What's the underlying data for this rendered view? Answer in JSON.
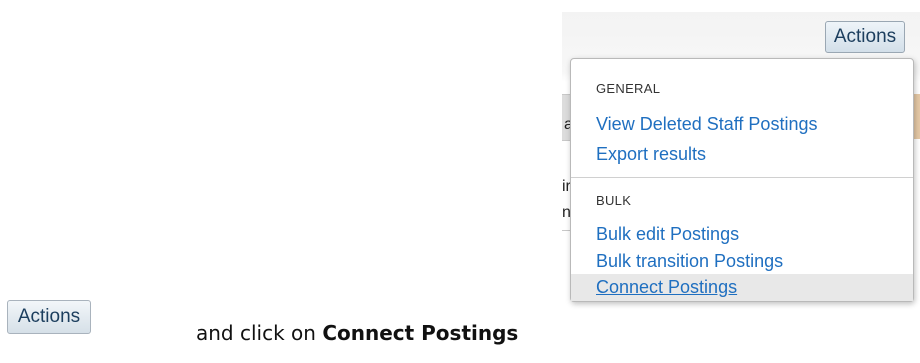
{
  "screenshot": {
    "actions_button_label": "Actions",
    "fragments": [
      "a",
      "ir",
      "n"
    ],
    "menu": {
      "sections": [
        {
          "header": "GENERAL",
          "items": [
            "View Deleted Staff Postings",
            "Export results"
          ]
        },
        {
          "header": "BULK",
          "items": [
            "Bulk edit Postings",
            "Bulk transition Postings",
            "Connect Postings"
          ]
        }
      ],
      "highlighted_item": "Connect Postings"
    }
  },
  "instruction": {
    "button_label": "Actions",
    "text_prefix": "and click on ",
    "text_bold": "Connect Postings"
  },
  "colors": {
    "link": "#1f6fc0",
    "button_text": "#1c3e5e"
  }
}
